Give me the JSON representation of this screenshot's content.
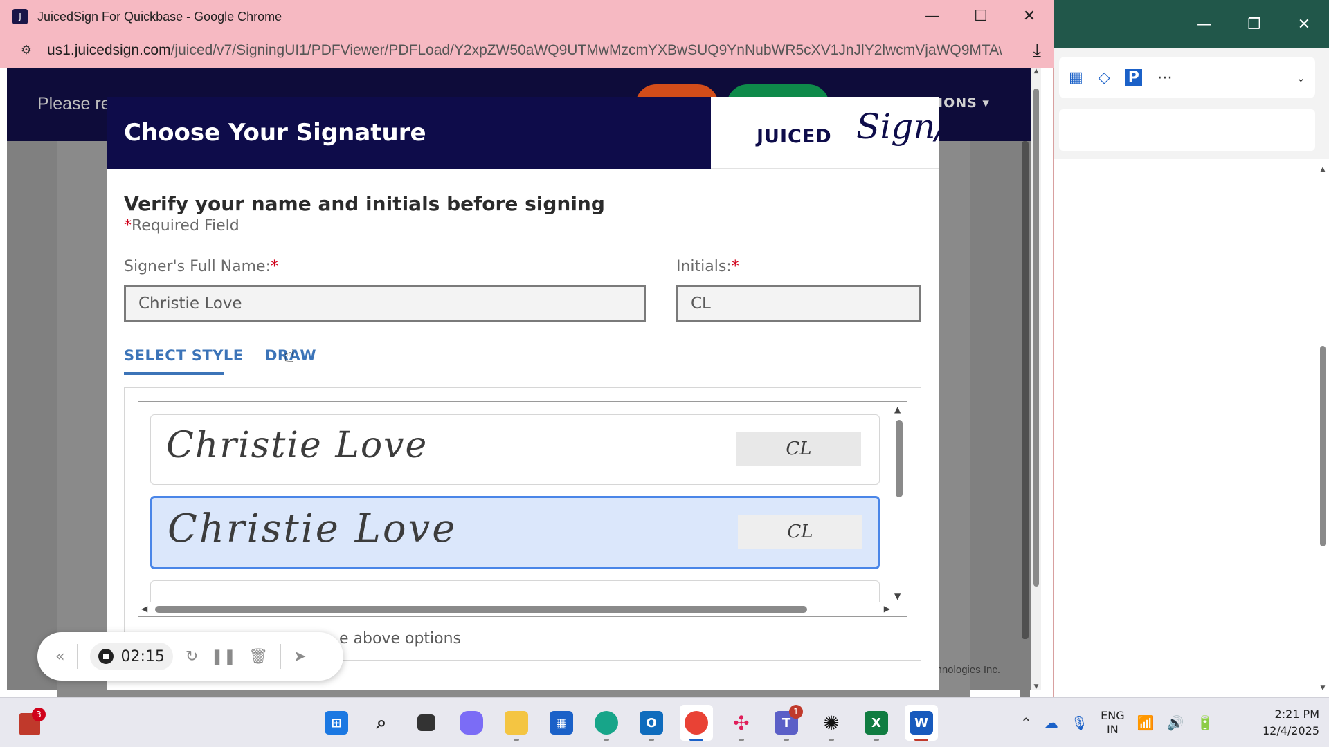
{
  "chrome": {
    "title": "JuicedSign For Quickbase - Google Chrome",
    "url_host": "us1.juicedsign.com",
    "url_path": "/juiced/v7/SigningUI1/PDFViewer/PDFLoad/Y2xpZW50aWQ9UTMwMzcmYXBwSUQ9YnNubWR5cXV1JnJlY2lwcmVjaWQ9MTAw..."
  },
  "page": {
    "header_text": "Please re",
    "options_label": "IONS ▾",
    "footer_text": "chnologies Inc."
  },
  "modal": {
    "title": "Choose Your Signature",
    "logo_juiced": "JUICED",
    "logo_sign": "Sign/",
    "verify_heading": "Verify your name and initials before signing",
    "required_star": "*",
    "required_text": "Required Field",
    "full_name_label": "Signer's Full Name:",
    "full_name_value": "Christie Love",
    "initials_label": "Initials:",
    "initials_value": "CL",
    "tab_select_style": "SELECT STYLE",
    "tab_draw": "DRAW",
    "signature_options": [
      {
        "signature": "Christie Love",
        "initials": "CL",
        "selected": false
      },
      {
        "signature": "Christie Love",
        "initials": "CL",
        "selected": true
      }
    ],
    "bottom_text": "e above options"
  },
  "recorder": {
    "collapse": "«",
    "time": "02:15",
    "restart": "↻",
    "pause": "❚❚",
    "delete": "🗑",
    "pointer": "➤"
  },
  "taskbar": {
    "books_badge": "3",
    "teams_badge": "1",
    "lang_line1": "ENG",
    "lang_line2": "IN",
    "time": "2:21 PM",
    "date": "12/4/2025"
  },
  "colors": {
    "modal_header": "#0e0c4a",
    "accent_blue": "#3c74b8",
    "selected_bg": "#dbe7fb",
    "selected_border": "#4a86e8",
    "chrome_titlebar": "#f6b9c2",
    "required_red": "#d0021b"
  }
}
